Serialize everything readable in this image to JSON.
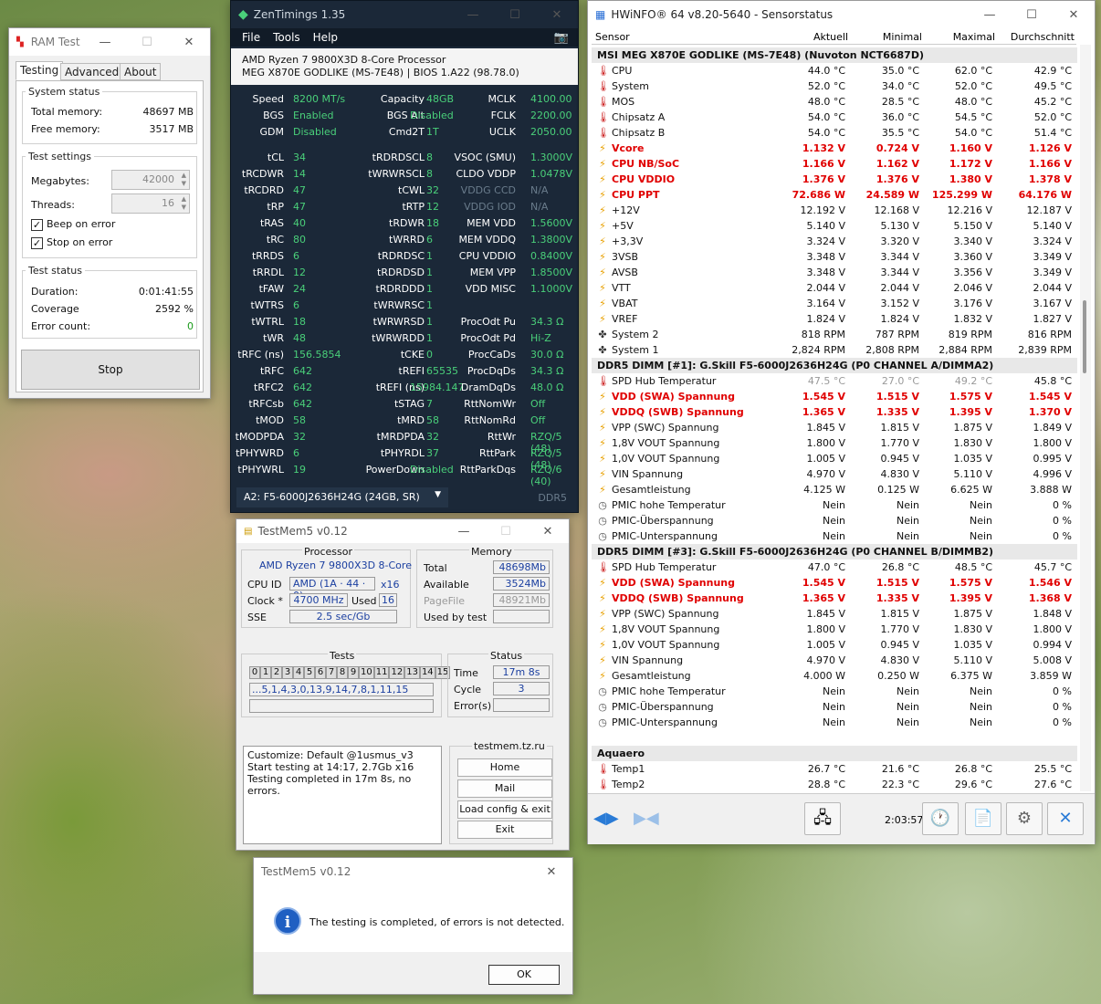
{
  "zen": {
    "title": "ZenTimings 1.35",
    "menu": [
      "File",
      "Tools",
      "Help"
    ],
    "cpu": "AMD Ryzen 7 9800X3D 8-Core Processor",
    "board": "MEG X870E GODLIKE (MS-7E48) | BIOS 1.A22 (98.78.0)",
    "rows": [
      [
        "Speed",
        "8200 MT/s",
        "Capacity",
        "48GB",
        "MCLK",
        "4100.00"
      ],
      [
        "BGS",
        "Enabled",
        "BGS Alt",
        "Disabled",
        "FCLK",
        "2200.00"
      ],
      [
        "GDM",
        "Disabled",
        "Cmd2T",
        "1T",
        "UCLK",
        "2050.00"
      ],
      [
        "tCL",
        "34",
        "tRDRDSCL",
        "8",
        "VSOC (SMU)",
        "1.3000V"
      ],
      [
        "tRCDWR",
        "14",
        "tWRWRSCL",
        "8",
        "CLDO VDDP",
        "1.0478V"
      ],
      [
        "tRCDRD",
        "47",
        "tCWL",
        "32",
        "VDDG CCD",
        "N/A"
      ],
      [
        "tRP",
        "47",
        "tRTP",
        "12",
        "VDDG IOD",
        "N/A"
      ],
      [
        "tRAS",
        "40",
        "tRDWR",
        "18",
        "MEM VDD",
        "1.5600V"
      ],
      [
        "tRC",
        "80",
        "tWRRD",
        "6",
        "MEM VDDQ",
        "1.3800V"
      ],
      [
        "tRRDS",
        "6",
        "tRDRDSC",
        "1",
        "CPU VDDIO",
        "0.8400V"
      ],
      [
        "tRRDL",
        "12",
        "tRDRDSD",
        "1",
        "MEM VPP",
        "1.8500V"
      ],
      [
        "tFAW",
        "24",
        "tRDRDDD",
        "1",
        "VDD MISC",
        "1.1000V"
      ],
      [
        "tWTRS",
        "6",
        "tWRWRSC",
        "1",
        "",
        ""
      ],
      [
        "tWTRL",
        "18",
        "tWRWRSD",
        "1",
        "ProcOdt Pu",
        "34.3 Ω"
      ],
      [
        "tWR",
        "48",
        "tWRWRDD",
        "1",
        "ProcOdt Pd",
        "Hi-Z"
      ],
      [
        "tRFC (ns)",
        "156.5854",
        "tCKE",
        "0",
        "ProcCaDs",
        "30.0 Ω"
      ],
      [
        "tRFC",
        "642",
        "tREFI",
        "65535",
        "ProcDqDs",
        "34.3 Ω"
      ],
      [
        "tRFC2",
        "642",
        "tREFI (ns)",
        "15984.147",
        "DramDqDs",
        "48.0 Ω"
      ],
      [
        "tRFCsb",
        "642",
        "tSTAG",
        "7",
        "RttNomWr",
        "Off"
      ],
      [
        "tMOD",
        "58",
        "tMRD",
        "58",
        "RttNomRd",
        "Off"
      ],
      [
        "tMODPDA",
        "32",
        "tMRDPDA",
        "32",
        "RttWr",
        "RZQ/5 (48)"
      ],
      [
        "tPHYWRD",
        "6",
        "tPHYRDL",
        "37",
        "RttPark",
        "RZQ/5 (48)"
      ],
      [
        "tPHYWRL",
        "19",
        "PowerDown",
        "Disabled",
        "RttParkDqs",
        "RZQ/6 (40)"
      ]
    ],
    "dimm_select": "A2: F5-6000J2636H24G (24GB, SR)",
    "ddr": "DDR5"
  },
  "hw": {
    "title": "HWiNFO® 64 v8.20-5640 - Sensorstatus",
    "headers": [
      "Sensor",
      "Aktuell",
      "Minimal",
      "Maximal",
      "Durchschnitt"
    ],
    "rows": [
      {
        "t": "sec",
        "n": "MSI MEG X870E GODLIKE (MS-7E48) (Nuvoton NCT6687D)"
      },
      {
        "i": "temp",
        "n": "CPU",
        "v": [
          "44.0 °C",
          "35.0 °C",
          "62.0 °C",
          "42.9 °C"
        ]
      },
      {
        "i": "temp",
        "n": "System",
        "v": [
          "52.0 °C",
          "34.0 °C",
          "52.0 °C",
          "49.5 °C"
        ]
      },
      {
        "i": "temp",
        "n": "MOS",
        "v": [
          "48.0 °C",
          "28.5 °C",
          "48.0 °C",
          "45.2 °C"
        ]
      },
      {
        "i": "temp",
        "n": "Chipsatz A",
        "v": [
          "54.0 °C",
          "36.0 °C",
          "54.5 °C",
          "52.0 °C"
        ]
      },
      {
        "i": "temp",
        "n": "Chipsatz B",
        "v": [
          "54.0 °C",
          "35.5 °C",
          "54.0 °C",
          "51.4 °C"
        ]
      },
      {
        "i": "volt",
        "red": 1,
        "n": "Vcore",
        "v": [
          "1.132 V",
          "0.724 V",
          "1.160 V",
          "1.126 V"
        ]
      },
      {
        "i": "volt",
        "red": 1,
        "n": "CPU NB/SoC",
        "v": [
          "1.166 V",
          "1.162 V",
          "1.172 V",
          "1.166 V"
        ]
      },
      {
        "i": "volt",
        "red": 1,
        "n": "CPU VDDIO",
        "v": [
          "1.376 V",
          "1.376 V",
          "1.380 V",
          "1.378 V"
        ]
      },
      {
        "i": "volt",
        "red": 1,
        "n": "CPU PPT",
        "v": [
          "72.686 W",
          "24.589 W",
          "125.299 W",
          "64.176 W"
        ]
      },
      {
        "i": "volt",
        "n": "+12V",
        "v": [
          "12.192 V",
          "12.168 V",
          "12.216 V",
          "12.187 V"
        ]
      },
      {
        "i": "volt",
        "n": "+5V",
        "v": [
          "5.140 V",
          "5.130 V",
          "5.150 V",
          "5.140 V"
        ]
      },
      {
        "i": "volt",
        "n": "+3,3V",
        "v": [
          "3.324 V",
          "3.320 V",
          "3.340 V",
          "3.324 V"
        ]
      },
      {
        "i": "volt",
        "n": "3VSB",
        "v": [
          "3.348 V",
          "3.344 V",
          "3.360 V",
          "3.349 V"
        ]
      },
      {
        "i": "volt",
        "n": "AVSB",
        "v": [
          "3.348 V",
          "3.344 V",
          "3.356 V",
          "3.349 V"
        ]
      },
      {
        "i": "volt",
        "n": "VTT",
        "v": [
          "2.044 V",
          "2.044 V",
          "2.046 V",
          "2.044 V"
        ]
      },
      {
        "i": "volt",
        "n": "VBAT",
        "v": [
          "3.164 V",
          "3.152 V",
          "3.176 V",
          "3.167 V"
        ]
      },
      {
        "i": "volt",
        "n": "VREF",
        "v": [
          "1.824 V",
          "1.824 V",
          "1.832 V",
          "1.827 V"
        ]
      },
      {
        "i": "fan",
        "n": "System 2",
        "v": [
          "818 RPM",
          "787 RPM",
          "819 RPM",
          "816 RPM"
        ]
      },
      {
        "i": "fan",
        "n": "System 1",
        "v": [
          "2,824 RPM",
          "2,808 RPM",
          "2,884 RPM",
          "2,839 RPM"
        ]
      },
      {
        "t": "sec",
        "n": "DDR5 DIMM [#1]: G.Skill F5-6000J2636H24G (P0 CHANNEL A/DIMMA2)"
      },
      {
        "i": "temp",
        "n": "SPD Hub Temperatur",
        "dim": 1,
        "v": [
          "47.5 °C",
          "27.0 °C",
          "49.2 °C",
          "45.8 °C"
        ]
      },
      {
        "i": "volt",
        "red": 1,
        "n": "VDD (SWA) Spannung",
        "v": [
          "1.545 V",
          "1.515 V",
          "1.575 V",
          "1.545 V"
        ]
      },
      {
        "i": "volt",
        "red": 1,
        "n": "VDDQ (SWB) Spannung",
        "v": [
          "1.365 V",
          "1.335 V",
          "1.395 V",
          "1.370 V"
        ]
      },
      {
        "i": "volt",
        "n": "VPP (SWC) Spannung",
        "v": [
          "1.845 V",
          "1.815 V",
          "1.875 V",
          "1.849 V"
        ]
      },
      {
        "i": "volt",
        "n": "1,8V VOUT Spannung",
        "v": [
          "1.800 V",
          "1.770 V",
          "1.830 V",
          "1.800 V"
        ]
      },
      {
        "i": "volt",
        "n": "1,0V VOUT Spannung",
        "v": [
          "1.005 V",
          "0.945 V",
          "1.035 V",
          "0.995 V"
        ]
      },
      {
        "i": "volt",
        "n": "VIN Spannung",
        "v": [
          "4.970 V",
          "4.830 V",
          "5.110 V",
          "4.996 V"
        ]
      },
      {
        "i": "volt",
        "n": "Gesamtleistung",
        "v": [
          "4.125 W",
          "0.125 W",
          "6.625 W",
          "3.888 W"
        ]
      },
      {
        "i": "clock",
        "n": "PMIC hohe Temperatur",
        "v": [
          "Nein",
          "Nein",
          "Nein",
          "0 %"
        ]
      },
      {
        "i": "clock",
        "n": "PMIC-Überspannung",
        "v": [
          "Nein",
          "Nein",
          "Nein",
          "0 %"
        ]
      },
      {
        "i": "clock",
        "n": "PMIC-Unterspannung",
        "v": [
          "Nein",
          "Nein",
          "Nein",
          "0 %"
        ]
      },
      {
        "t": "sec",
        "n": "DDR5 DIMM [#3]: G.Skill F5-6000J2636H24G (P0 CHANNEL B/DIMMB2)"
      },
      {
        "i": "temp",
        "n": "SPD Hub Temperatur",
        "v": [
          "47.0 °C",
          "26.8 °C",
          "48.5 °C",
          "45.7 °C"
        ]
      },
      {
        "i": "volt",
        "red": 1,
        "n": "VDD (SWA) Spannung",
        "v": [
          "1.545 V",
          "1.515 V",
          "1.575 V",
          "1.546 V"
        ]
      },
      {
        "i": "volt",
        "red": 1,
        "n": "VDDQ (SWB) Spannung",
        "v": [
          "1.365 V",
          "1.335 V",
          "1.395 V",
          "1.368 V"
        ]
      },
      {
        "i": "volt",
        "n": "VPP (SWC) Spannung",
        "v": [
          "1.845 V",
          "1.815 V",
          "1.875 V",
          "1.848 V"
        ]
      },
      {
        "i": "volt",
        "n": "1,8V VOUT Spannung",
        "v": [
          "1.800 V",
          "1.770 V",
          "1.830 V",
          "1.800 V"
        ]
      },
      {
        "i": "volt",
        "n": "1,0V VOUT Spannung",
        "v": [
          "1.005 V",
          "0.945 V",
          "1.035 V",
          "0.994 V"
        ]
      },
      {
        "i": "volt",
        "n": "VIN Spannung",
        "v": [
          "4.970 V",
          "4.830 V",
          "5.110 V",
          "5.008 V"
        ]
      },
      {
        "i": "volt",
        "n": "Gesamtleistung",
        "v": [
          "4.000 W",
          "0.250 W",
          "6.375 W",
          "3.859 W"
        ]
      },
      {
        "i": "clock",
        "n": "PMIC hohe Temperatur",
        "v": [
          "Nein",
          "Nein",
          "Nein",
          "0 %"
        ]
      },
      {
        "i": "clock",
        "n": "PMIC-Überspannung",
        "v": [
          "Nein",
          "Nein",
          "Nein",
          "0 %"
        ]
      },
      {
        "i": "clock",
        "n": "PMIC-Unterspannung",
        "v": [
          "Nein",
          "Nein",
          "Nein",
          "0 %"
        ]
      },
      {
        "t": "blank",
        "n": ""
      },
      {
        "t": "sec",
        "n": "Aquaero"
      },
      {
        "i": "temp",
        "n": "Temp1",
        "v": [
          "26.7 °C",
          "21.6 °C",
          "26.8 °C",
          "25.5 °C"
        ]
      },
      {
        "i": "temp",
        "n": "Temp2",
        "v": [
          "28.8 °C",
          "22.3 °C",
          "29.6 °C",
          "27.6 °C"
        ]
      }
    ],
    "elapsed": "2:03:57"
  },
  "ram": {
    "title": "RAM Test",
    "tabs": [
      "Testing",
      "Advanced",
      "About"
    ],
    "system_status": "System status",
    "total_label": "Total memory:",
    "total": "48697 MB",
    "free_label": "Free memory:",
    "free": "3517 MB",
    "test_settings": "Test settings",
    "mb_label": "Megabytes:",
    "mb": "42000",
    "threads_label": "Threads:",
    "threads": "16",
    "beep": "Beep on error",
    "stop_on_error": "Stop on error",
    "test_status": "Test status",
    "duration_label": "Duration:",
    "duration": "0:01:41:55",
    "coverage_label": "Coverage",
    "coverage": "2592 %",
    "errors_label": "Error count:",
    "errors": "0",
    "stop": "Stop"
  },
  "tm": {
    "title": "TestMem5 v0.12",
    "processor": "Processor",
    "cpu": "AMD Ryzen 7 9800X3D 8-Core",
    "cpuid_label": "CPU ID",
    "cpuid": "AMD  (1A · 44 · 0)",
    "cpuid_x": "x16",
    "clock_label": "Clock *",
    "clock": "4700 MHz",
    "used_label": "Used",
    "used": "16",
    "sse_label": "SSE",
    "sse": "2.5 sec/Gb",
    "memory": "Memory",
    "total_label": "Total",
    "total": "48698Mb",
    "avail_label": "Available",
    "avail": "3524Mb",
    "pagefile_label": "PageFile",
    "pagefile": "48921Mb",
    "usedby_label": "Used by test",
    "usedby": "",
    "tests": "Tests",
    "test_nums": [
      "0",
      "1",
      "2",
      "3",
      "4",
      "5",
      "6",
      "7",
      "8",
      "9",
      "10",
      "11",
      "12",
      "13",
      "14",
      "15"
    ],
    "sequence": "...5,1,4,3,0,13,9,14,7,8,1,11,15",
    "status": "Status",
    "time_label": "Time",
    "time": "17m 8s",
    "cycle_label": "Cycle",
    "cycle": "3",
    "errors_label": "Error(s)",
    "errors": "",
    "log": [
      "Customize: Default @1usmus_v3",
      "Start testing at 14:17, 2.7Gb x16",
      "Testing completed in 17m 8s, no errors."
    ],
    "site": "testmem.tz.ru",
    "buttons": [
      "Home",
      "Mail",
      "Load config & exit",
      "Exit"
    ]
  },
  "dlg": {
    "title": "TestMem5 v0.12",
    "message": "The testing is completed, of errors is not detected.",
    "ok": "OK"
  }
}
